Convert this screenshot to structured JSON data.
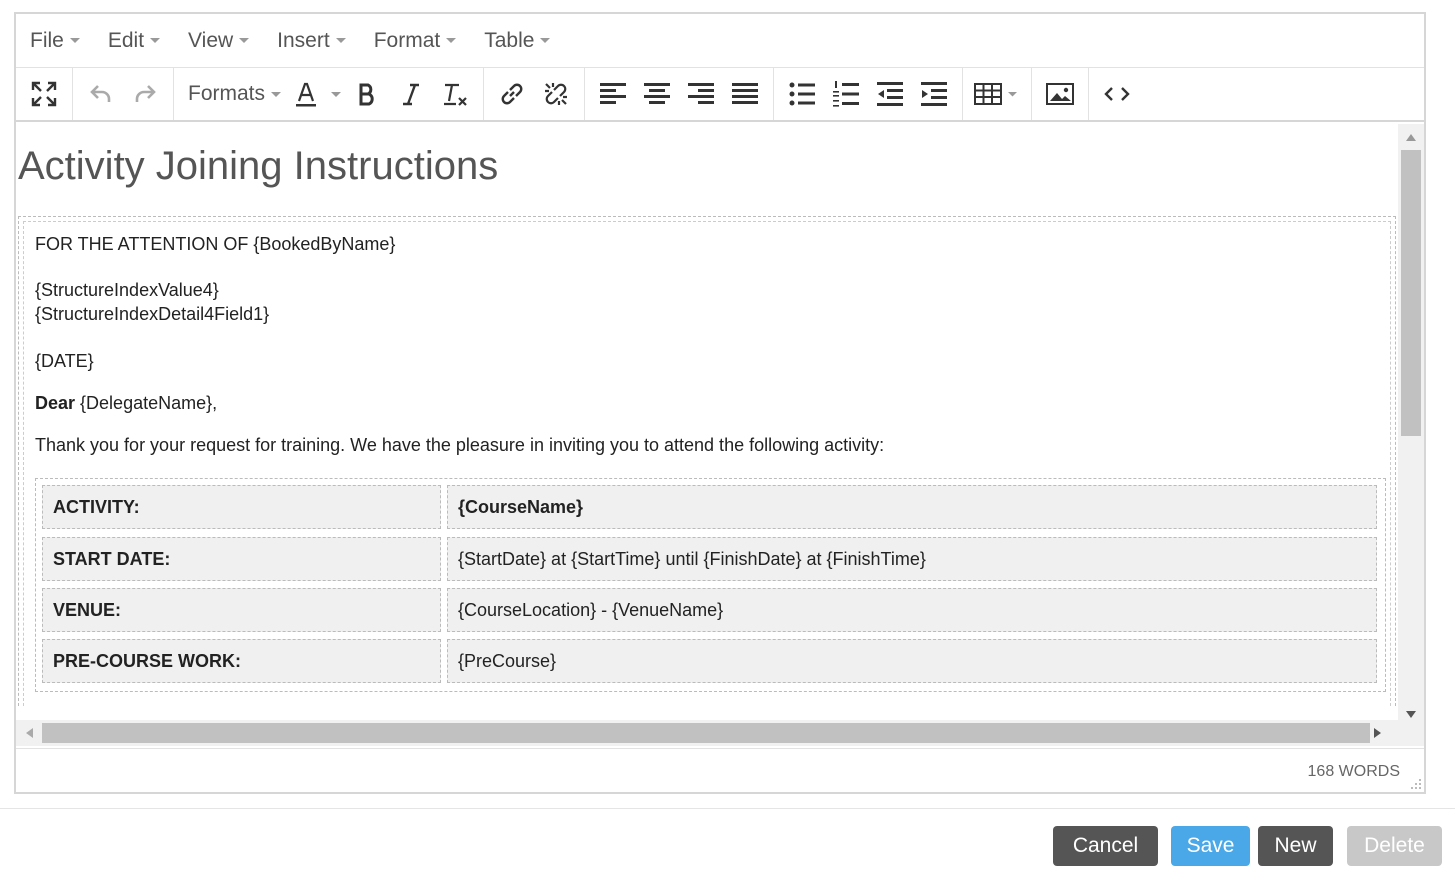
{
  "menubar": {
    "items": [
      {
        "label": "File"
      },
      {
        "label": "Edit"
      },
      {
        "label": "View"
      },
      {
        "label": "Insert"
      },
      {
        "label": "Format"
      },
      {
        "label": "Table"
      }
    ]
  },
  "toolbar": {
    "formats_label": "Formats",
    "icons": [
      "fullscreen-icon",
      "undo-icon",
      "redo-icon",
      "text-color-icon",
      "bold-icon",
      "italic-icon",
      "clear-formatting-icon",
      "link-icon",
      "unlink-icon",
      "align-left-icon",
      "align-center-icon",
      "align-right-icon",
      "justify-icon",
      "bullet-list-icon",
      "numbered-list-icon",
      "outdent-icon",
      "indent-icon",
      "table-icon",
      "image-icon",
      "source-code-icon"
    ]
  },
  "document": {
    "title": "Activity Joining Instructions",
    "attention_line": "FOR THE ATTENTION OF {BookedByName}",
    "structure_value": "{StructureIndexValue4}",
    "structure_detail": "{StructureIndexDetail4Field1}",
    "date": "{DATE}",
    "greeting_bold": "Dear",
    "greeting_rest": " {DelegateName},",
    "intro": "Thank you for your request for training. We have the pleasure in inviting you to attend the following activity:",
    "table": [
      {
        "label": "ACTIVITY:",
        "value": "{CourseName}",
        "value_bold": true
      },
      {
        "label": "START DATE:",
        "value": "{StartDate} at {StartTime} until {FinishDate} at {FinishTime}",
        "value_bold": false
      },
      {
        "label": "VENUE:",
        "value": "{CourseLocation} - {VenueName}",
        "value_bold": false
      },
      {
        "label": "PRE-COURSE WORK:",
        "value": "{PreCourse}",
        "value_bold": false
      }
    ]
  },
  "status": {
    "word_count": "168 WORDS"
  },
  "actions": {
    "cancel_label": "Cancel",
    "save_label": "Save",
    "new_label": "New",
    "delete_label": "Delete"
  },
  "colors": {
    "cancel_bg": "#555555",
    "save_bg": "#4aa8e8",
    "new_bg": "#555555",
    "delete_bg": "#c8c8c8"
  }
}
